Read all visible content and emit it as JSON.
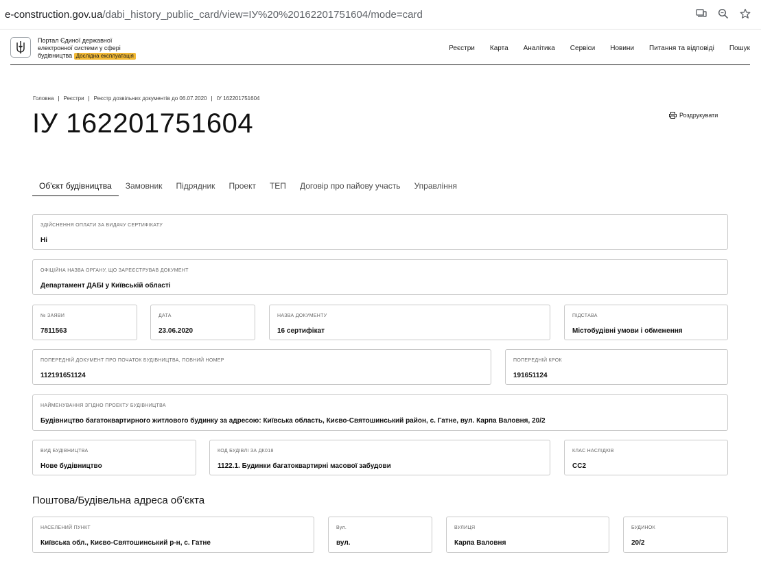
{
  "browser": {
    "url_host": "e-construction.gov.ua",
    "url_path": "/dabi_history_public_card/view=ІУ%20%20162201751604/mode=card"
  },
  "header": {
    "logo_line1": "Портал Єдиної державної",
    "logo_line2": "електронної системи у сфері",
    "logo_line3": "будівництва",
    "badge": "Дослідна експлуатація",
    "nav": [
      "Реєстри",
      "Карта",
      "Аналітика",
      "Сервіси",
      "Новини",
      "Питання та відповіді",
      "Пошук"
    ]
  },
  "breadcrumb": [
    "Головна",
    "Реєстри",
    "Реєстр дозвільних документів до 06.07.2020",
    "ІУ 162201751604"
  ],
  "title": "ІУ 162201751604",
  "print_label": "Роздрукувати",
  "tabs": [
    "Об'єкт будівництва",
    "Замовник",
    "Підрядник",
    "Проект",
    "ТЕП",
    "Договір про пайову участь",
    "Управління"
  ],
  "fields": {
    "payment": {
      "label": "Здійснення оплати за видачу сертифікату",
      "value": "Ні"
    },
    "authority": {
      "label": "Офіційна назва органу, що зареєстрував документ",
      "value": "Департамент ДАБІ у Київській області"
    },
    "app_no": {
      "label": "№ заяви",
      "value": "7811563"
    },
    "date": {
      "label": "Дата",
      "value": "23.06.2020"
    },
    "doc_name": {
      "label": "Назва документу",
      "value": "16 сертифікат"
    },
    "basis": {
      "label": "Підстава",
      "value": "Містобудівні умови і обмеження"
    },
    "prev_doc": {
      "label": "Попередній документ про початок будівництва, повний номер",
      "value": "112191651124"
    },
    "prev_step": {
      "label": "Попередній крок",
      "value": "191651124"
    },
    "project_name": {
      "label": "Найменування згідно проекту будівництва",
      "value": "Будівництво багатоквартирного житлового будинку за адресою: Київська область, Києво-Святошинський район, с. Гатне, вул. Карпа Валовня, 20/2"
    },
    "build_type": {
      "label": "Вид будівництва",
      "value": "Нове будівництво"
    },
    "building_code": {
      "label": "Код будівлі за ДК018",
      "value": "1122.1. Будинки багатоквартирні масової забудови"
    },
    "consequence_class": {
      "label": "Клас наслідків",
      "value": "СС2"
    }
  },
  "address_section": {
    "title": "Поштова/Будівельна адреса об'єкта",
    "locality": {
      "label": "Населений пункт",
      "value": "Київська обл., Києво-Святошинський р-н, с. Гатне"
    },
    "street_type": {
      "label": "Вул.",
      "value": "вул."
    },
    "street": {
      "label": "Вулиця",
      "value": "Карпа Валовня"
    },
    "house": {
      "label": "Будинок",
      "value": "20/2"
    }
  }
}
